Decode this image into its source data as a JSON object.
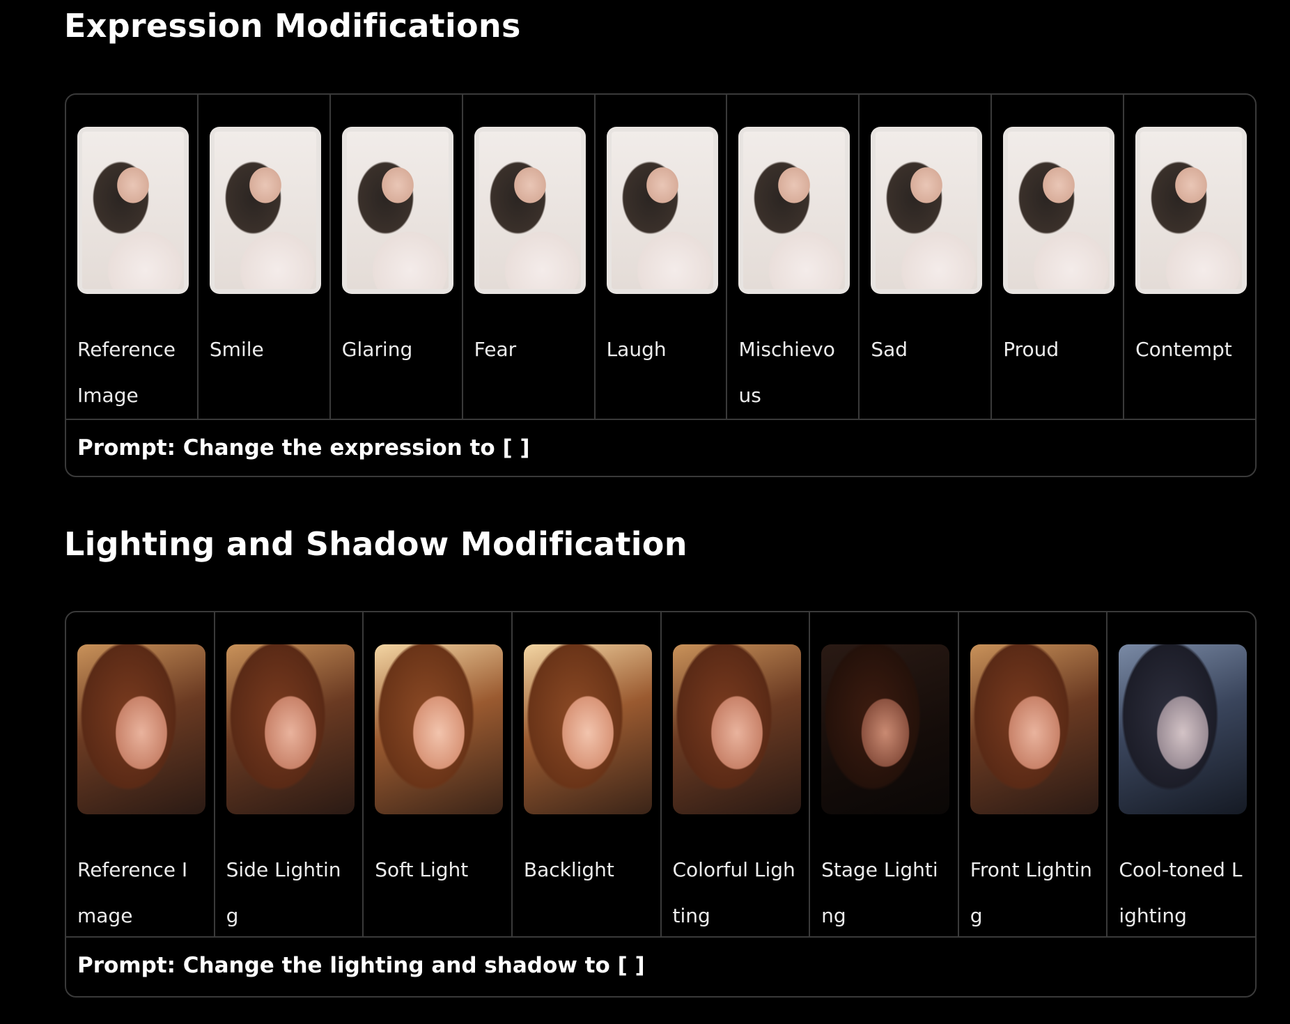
{
  "expression": {
    "title": "Expression Modifications",
    "cells": [
      {
        "label": "Reference Image"
      },
      {
        "label": "Smile"
      },
      {
        "label": "Glaring"
      },
      {
        "label": "Fear"
      },
      {
        "label": "Laugh"
      },
      {
        "label": "Mischievous"
      },
      {
        "label": "Sad"
      },
      {
        "label": "Proud"
      },
      {
        "label": "Contempt"
      }
    ],
    "prompt": "Prompt: Change the expression to [ ]"
  },
  "lighting": {
    "title": "Lighting and Shadow Modification",
    "cells": [
      {
        "label": "Reference Image"
      },
      {
        "label": "Side Lighting"
      },
      {
        "label": "Soft Light"
      },
      {
        "label": "Backlight"
      },
      {
        "label": "Colorful Lighting"
      },
      {
        "label": "Stage Lighting"
      },
      {
        "label": "Front Lighting"
      },
      {
        "label": "Cool-toned Lighting"
      }
    ],
    "prompt": "Prompt: Change the lighting and shadow to [ ]"
  }
}
